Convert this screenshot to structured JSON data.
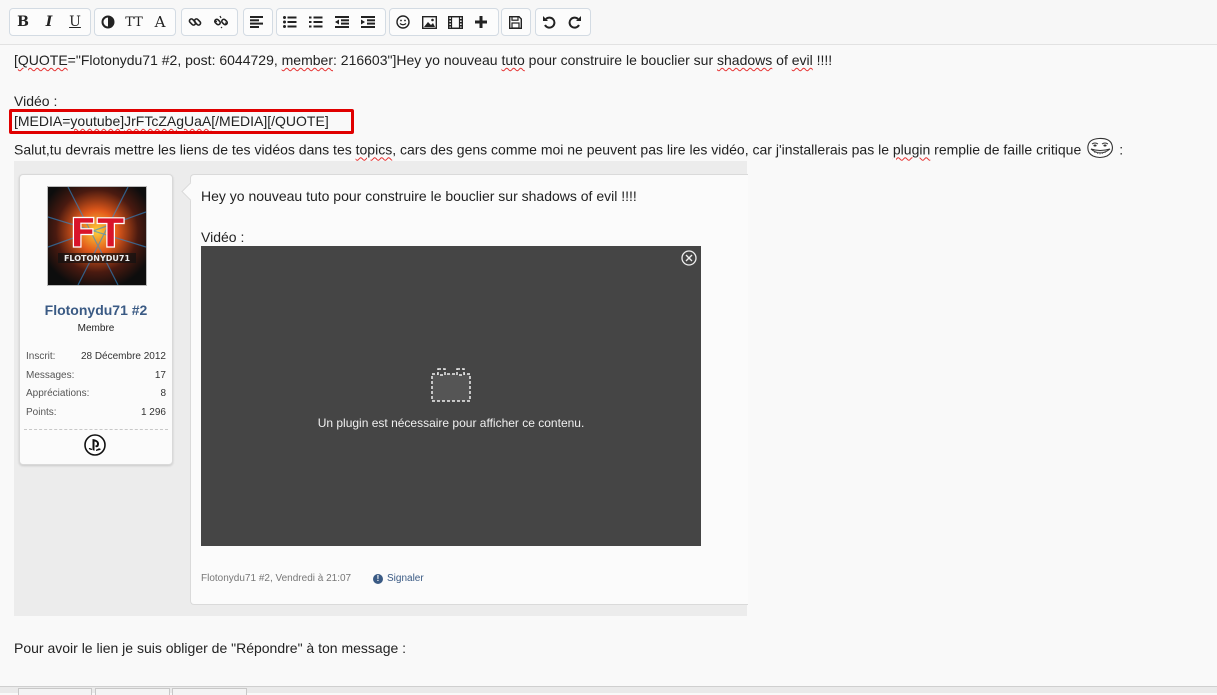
{
  "toolbar": {
    "groups": [
      [
        {
          "name": "bold-button",
          "label": "B",
          "icon": "bold-icon"
        },
        {
          "name": "italic-button",
          "label": "I",
          "icon": "italic-icon"
        },
        {
          "name": "underline-button",
          "label": "U",
          "icon": "underline-icon"
        }
      ],
      [
        {
          "name": "color-button",
          "icon": "contrast-icon"
        },
        {
          "name": "font-size-button",
          "label": "TT",
          "icon": "font-size-icon"
        },
        {
          "name": "font-family-button",
          "label": "A",
          "icon": "font-family-icon"
        }
      ],
      [
        {
          "name": "link-button",
          "icon": "link-icon"
        },
        {
          "name": "unlink-button",
          "icon": "unlink-icon"
        }
      ],
      [
        {
          "name": "align-button",
          "icon": "align-left-icon"
        }
      ],
      [
        {
          "name": "bullet-list-button",
          "icon": "bullet-list-icon"
        },
        {
          "name": "numbered-list-button",
          "icon": "numbered-list-icon"
        },
        {
          "name": "outdent-button",
          "icon": "outdent-icon"
        },
        {
          "name": "indent-button",
          "icon": "indent-icon"
        }
      ],
      [
        {
          "name": "smilie-button",
          "icon": "smiley-icon"
        },
        {
          "name": "image-button",
          "icon": "image-icon"
        },
        {
          "name": "media-button",
          "icon": "film-icon"
        },
        {
          "name": "insert-button",
          "icon": "plus-icon"
        }
      ],
      [
        {
          "name": "save-draft-button",
          "icon": "floppy-icon"
        }
      ],
      [
        {
          "name": "undo-button",
          "icon": "undo-icon"
        },
        {
          "name": "redo-button",
          "icon": "redo-icon"
        }
      ]
    ]
  },
  "editor": {
    "quote_line": {
      "p1": "[",
      "p2": "QUOTE",
      "p3": "=\"Flotonydu71 #2, post: 6044729, ",
      "p4": "member",
      "p5": ": 216603\"]Hey yo nouveau ",
      "p6": "tuto",
      "p7": " pour construire le bouclier sur ",
      "p8": "shadows",
      "p9": " of ",
      "p10": "evil",
      "p11": " !!!!"
    },
    "video_label": "Vidéo :",
    "media_line": {
      "p1": "[MEDIA=",
      "p2": "youtube",
      "p3": "]",
      "p4": "JrFTcZAgUaA",
      "p5": "[/MEDIA][/QUOTE]"
    },
    "reply_line": {
      "p1": "Salut,tu devrais mettre les liens de tes vidéos dans tes ",
      "p2": "topics",
      "p3": ", cars des gens comme moi ne peuvent pas lire les vidéo, car j'installerais pas le ",
      "p4": "plugin",
      "p5": " remplie de faille critique",
      "p6": ":"
    },
    "closing_line": "Pour avoir le lien je suis obliger de \"Répondre\" à ton message :"
  },
  "quoted_post": {
    "username": "Flotonydu71 #2",
    "user_title": "Membre",
    "avatar_text": "FT",
    "avatar_caption": "FLOTONYDU71",
    "stats": [
      {
        "key": "Inscrit:",
        "value": "28 Décembre 2012"
      },
      {
        "key": "Messages:",
        "value": "17"
      },
      {
        "key": "Appréciations:",
        "value": "8"
      },
      {
        "key": "Points:",
        "value": "1 296"
      }
    ],
    "message": "Hey yo nouveau tuto pour construire le bouclier sur shadows of evil !!!!",
    "video_label": "Vidéo :",
    "plugin_notice": "Un plugin est nécessaire pour afficher ce contenu.",
    "meta": "Flotonydu71 #2, Vendredi à 21:07",
    "report_label": "Signaler"
  },
  "colors": {
    "highlight_box": "#e00000",
    "username": "#3a5a84",
    "video_bg": "#454545",
    "spellcheck": "#e53030"
  }
}
